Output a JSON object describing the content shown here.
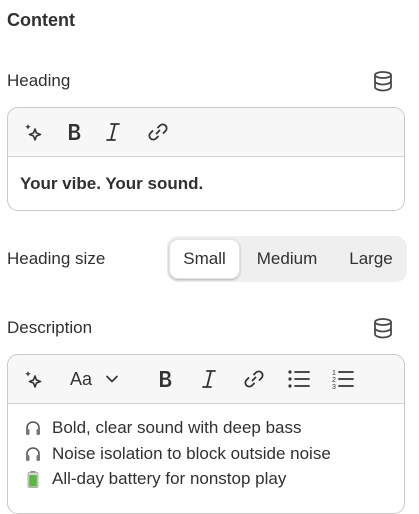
{
  "content": {
    "section_title": "Content",
    "heading": {
      "label": "Heading",
      "icon": "database-icon",
      "value": "Your vibe. Your sound."
    },
    "heading_size": {
      "label": "Heading size",
      "options": [
        "Small",
        "Medium",
        "Large"
      ],
      "selected": "Small"
    },
    "description": {
      "label": "Description",
      "icon": "database-icon",
      "font_button": "Aa",
      "lines": [
        {
          "icon": "headphones-icon",
          "text": "Bold, clear sound with deep bass"
        },
        {
          "icon": "headphones-icon",
          "text": "Noise isolation to block outside noise"
        },
        {
          "icon": "battery-icon",
          "text": "All-day battery for nonstop play"
        }
      ]
    }
  },
  "colors": {
    "text": "#303030",
    "border": "#c9c9c9",
    "segment_bg": "#efefef",
    "battery_green": "#5ab93c"
  }
}
